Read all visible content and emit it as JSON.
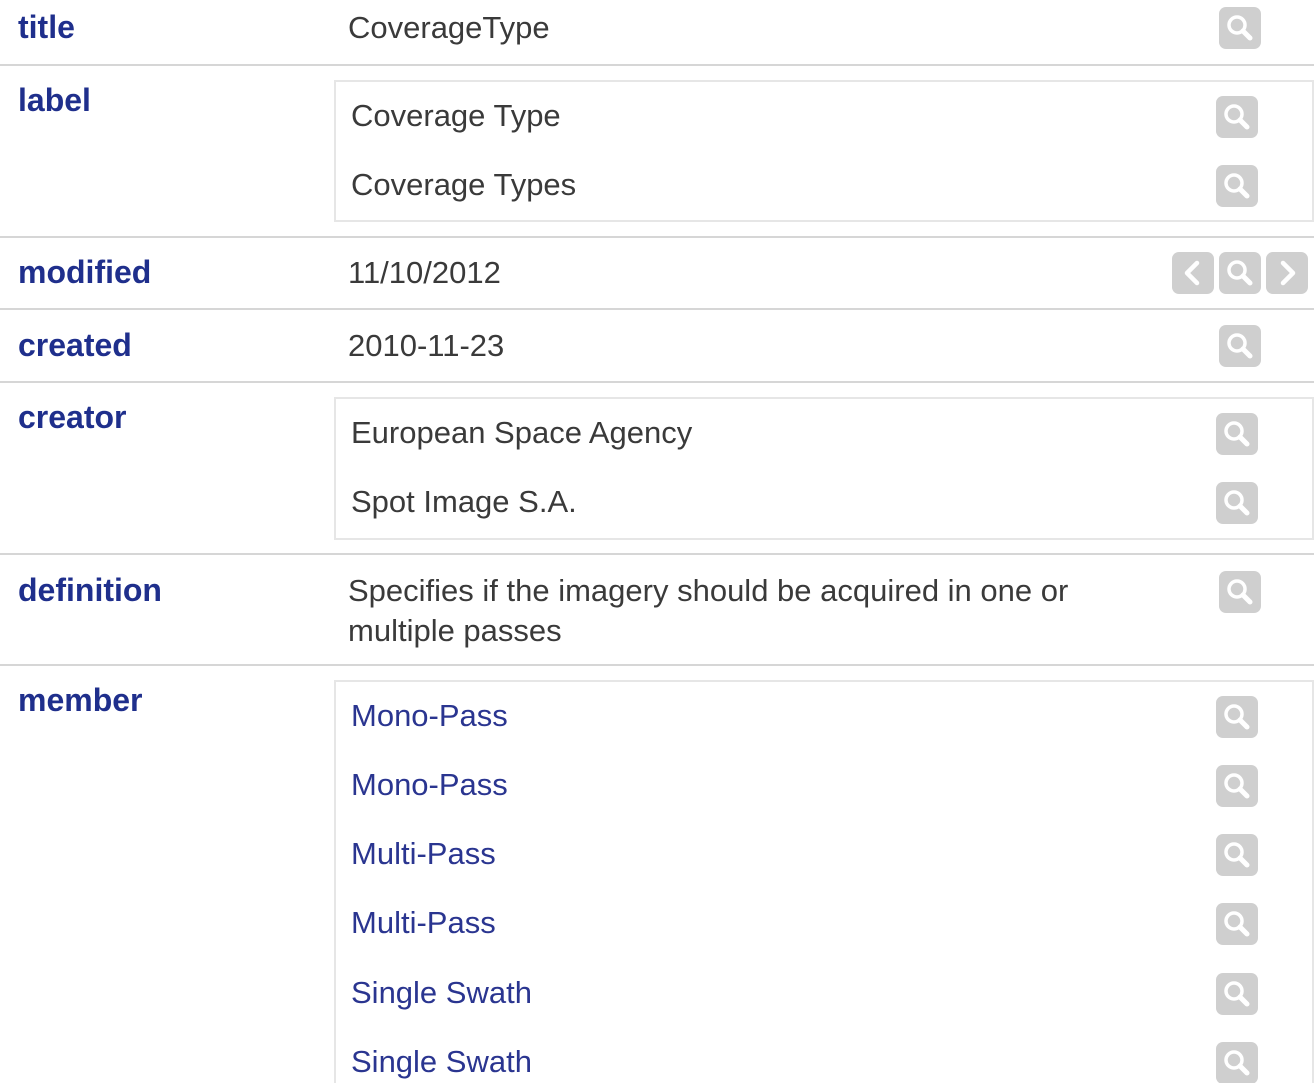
{
  "rows": {
    "title": {
      "name": "title",
      "values": [
        "CoverageType"
      ]
    },
    "label": {
      "name": "label",
      "values": [
        "Coverage Type",
        "Coverage Types"
      ]
    },
    "modified": {
      "name": "modified",
      "values": [
        "11/10/2012"
      ]
    },
    "created": {
      "name": "created",
      "values": [
        "2010-11-23"
      ]
    },
    "creator": {
      "name": "creator",
      "values": [
        "European Space Agency",
        "Spot Image S.A."
      ]
    },
    "definition": {
      "name": "definition",
      "values": [
        "Specifies if the imagery should be acquired in one or multiple passes"
      ]
    },
    "member": {
      "name": "member",
      "values": [
        "Mono-Pass",
        "Mono-Pass",
        "Multi-Pass",
        "Multi-Pass",
        "Single Swath",
        "Single Swath"
      ]
    }
  },
  "icons": {
    "search": "magnifier-icon",
    "prev": "chevron-left-icon",
    "next": "chevron-right-icon"
  },
  "colors": {
    "property_name": "#1f2f8c",
    "link_value": "#2a3590",
    "plain_value": "#3a3a3a",
    "icon_button_bg": "#cfcfcf",
    "divider": "#d6d6d6"
  }
}
